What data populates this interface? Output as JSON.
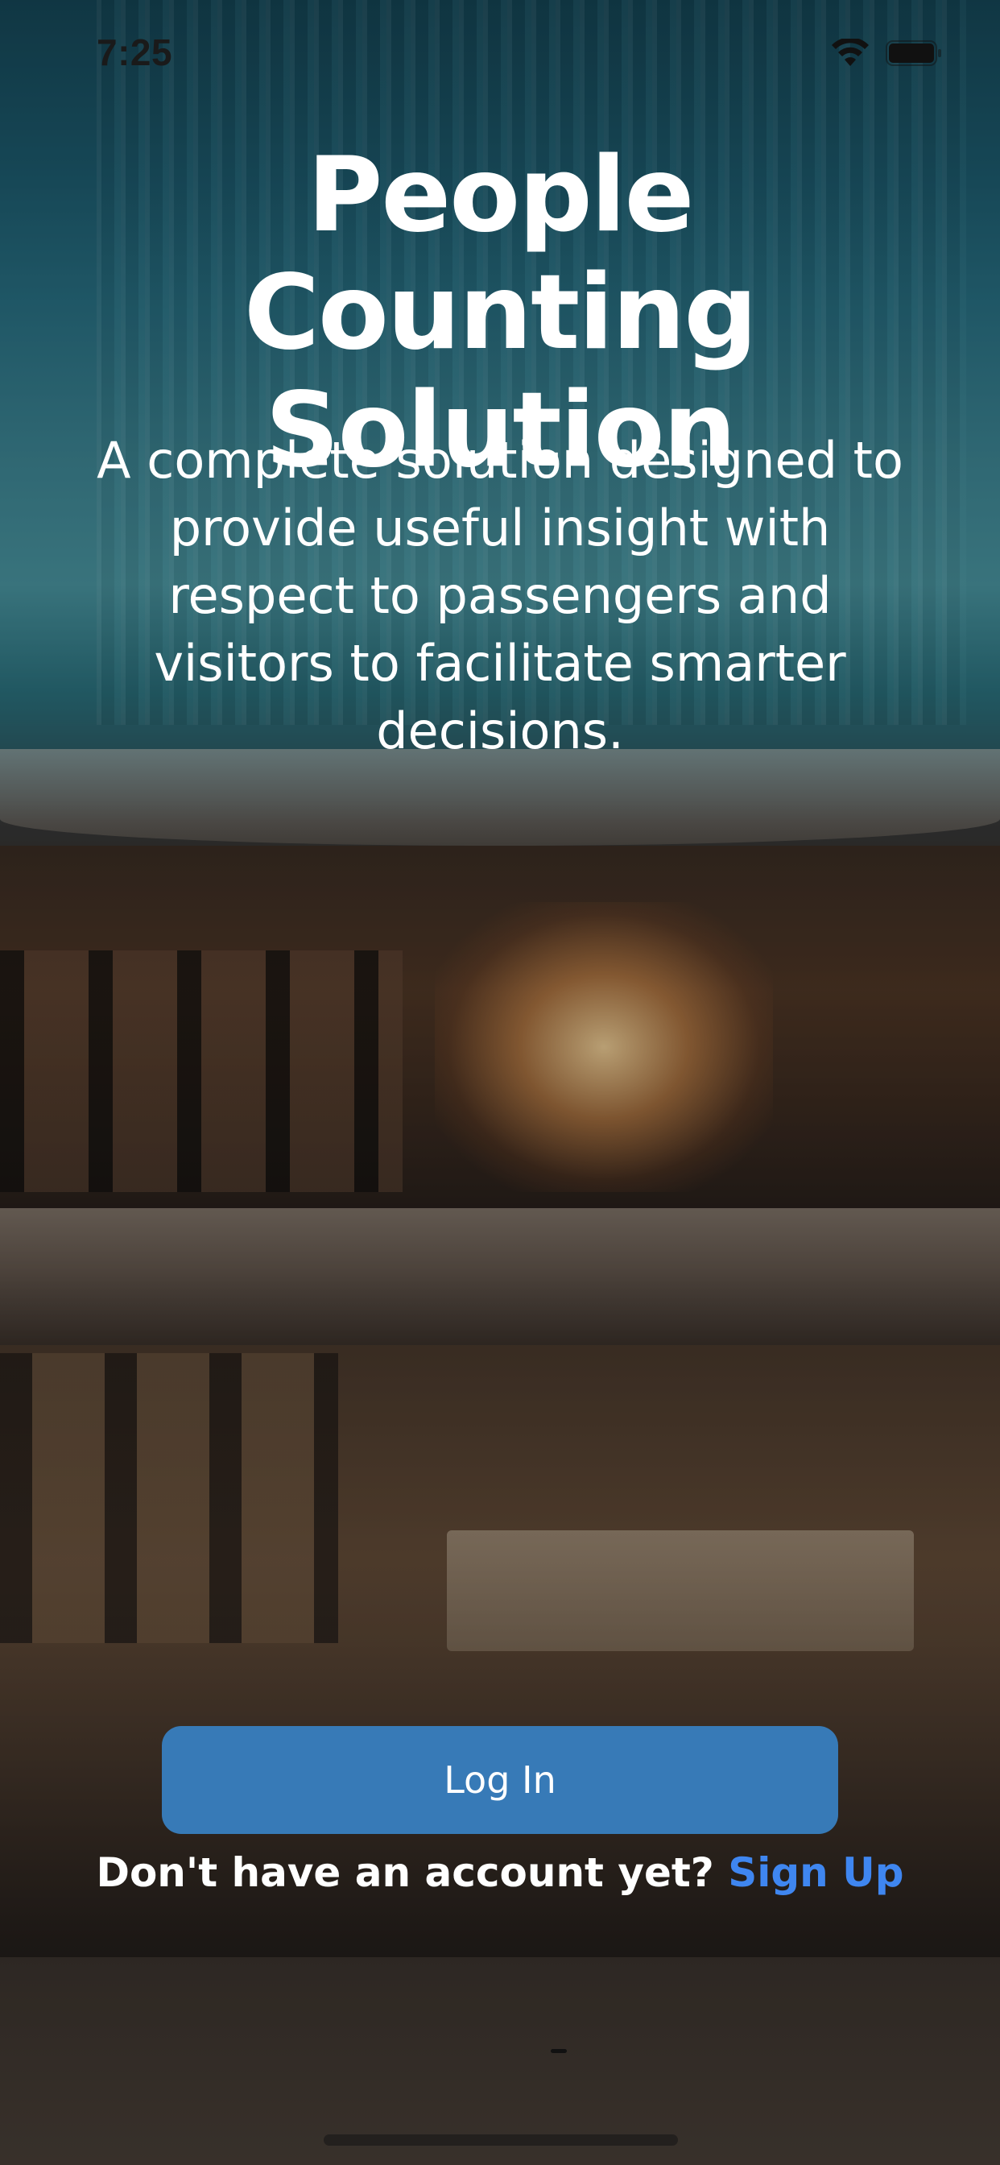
{
  "status_bar": {
    "time": "7:25",
    "icons": [
      "wifi-icon",
      "battery-icon"
    ]
  },
  "hero": {
    "title": "People Counting Solution",
    "subtitle": "A complete solution designed to provide useful insight with respect to passengers and visitors to facilitate smarter decisions."
  },
  "actions": {
    "login_label": "Log In",
    "signup_prompt": "Don't have an account yet?",
    "signup_link": "Sign Up"
  },
  "colors": {
    "login_button": "#377ab7",
    "signup_link": "#3f86f0",
    "text": "#ffffff"
  }
}
